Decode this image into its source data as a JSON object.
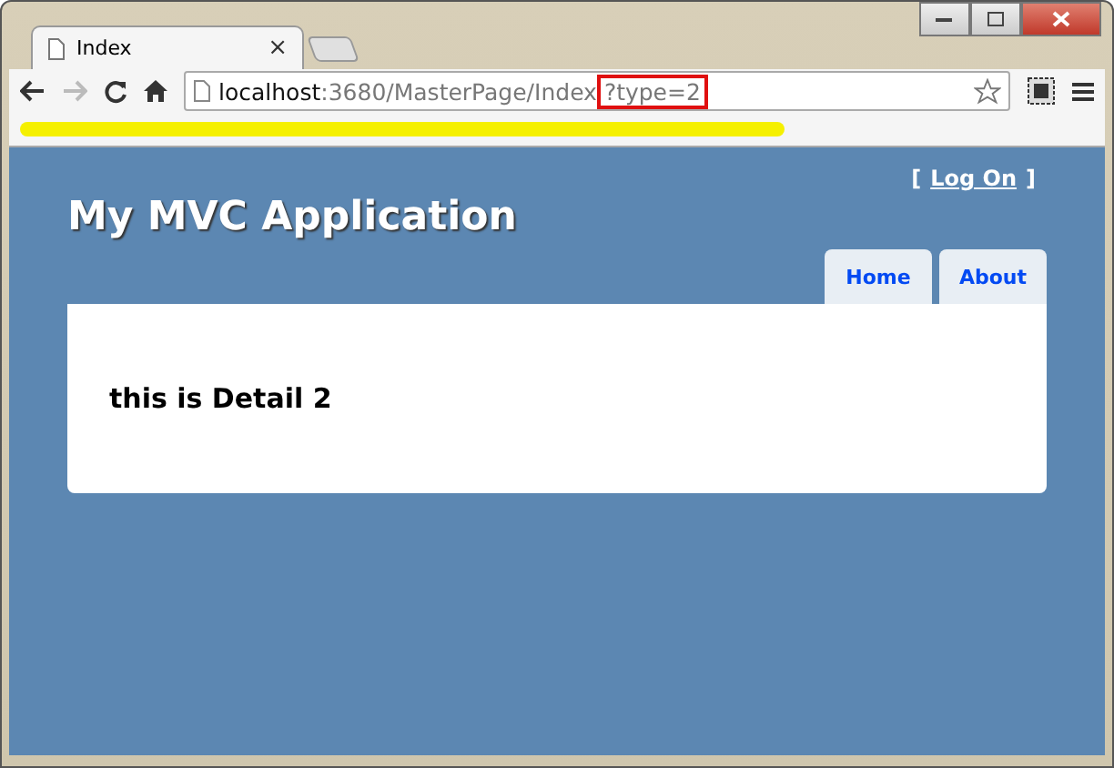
{
  "browser": {
    "tab_title": "Index",
    "close": "×",
    "url_host": "localhost",
    "url_path": ":3680/MasterPage/Index",
    "url_query": "?type=2"
  },
  "header": {
    "login_open": "[",
    "login_link": "Log On",
    "login_close": "]",
    "title": "My MVC Application"
  },
  "menu": [
    {
      "label": "Home"
    },
    {
      "label": "About"
    }
  ],
  "content": {
    "heading": "this is Detail 2"
  }
}
